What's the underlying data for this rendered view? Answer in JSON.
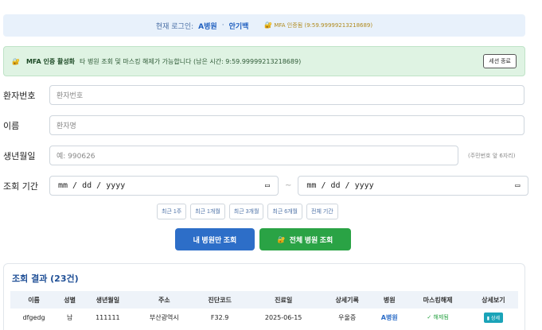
{
  "login_bar": {
    "label": "현재 로그인:",
    "hospital": "A병원",
    "separator": "·",
    "user": "안기백",
    "mfa_status": "MFA 인증됨 (9:59.99999213218689)"
  },
  "mfa_alert": {
    "title": "MFA 인증 활성화",
    "message": "타 병원 조회 및 마스킹 해제가 가능합니다 (남은 시간: 9:59.99999213218689)",
    "session_end_label": "세션 종료"
  },
  "form": {
    "patient_no": {
      "label": "환자번호",
      "placeholder": "환자번호"
    },
    "name": {
      "label": "이름",
      "placeholder": "환자명"
    },
    "birth": {
      "label": "생년월일",
      "placeholder": "예: 990626",
      "hint": "(주민번호 앞 6자리)"
    },
    "period": {
      "label": "조회 기간",
      "start": "mm / dd / yyyy",
      "end": "mm / dd / yyyy",
      "separator": "~"
    }
  },
  "quick_ranges": [
    "최근 1주",
    "최근 1개월",
    "최근 3개월",
    "최근 6개월",
    "전체 기간"
  ],
  "actions": {
    "my_hospital": "내 병원만 조회",
    "all_hospitals": "전체 병원 조회"
  },
  "results": {
    "title": "조회 결과 (23건)",
    "columns": [
      "이름",
      "성별",
      "생년월일",
      "주소",
      "진단코드",
      "진료일",
      "상세기록",
      "병원",
      "마스킹해제",
      "상세보기"
    ],
    "rows": [
      {
        "name": "dfgedg",
        "sex": "남",
        "birth": "111111",
        "address": "부산광역시",
        "diag_code": "F32.9",
        "visit_date": "2025-06-15",
        "record": "우울증",
        "hospital": "A병원",
        "unmask": "✓ 해제됨",
        "detail": "상세"
      }
    ]
  },
  "colors": {
    "accent_blue": "#2d6ec8",
    "accent_green": "#2aa345",
    "login_bg": "#e8f1fb",
    "alert_bg": "#dff3e3"
  }
}
